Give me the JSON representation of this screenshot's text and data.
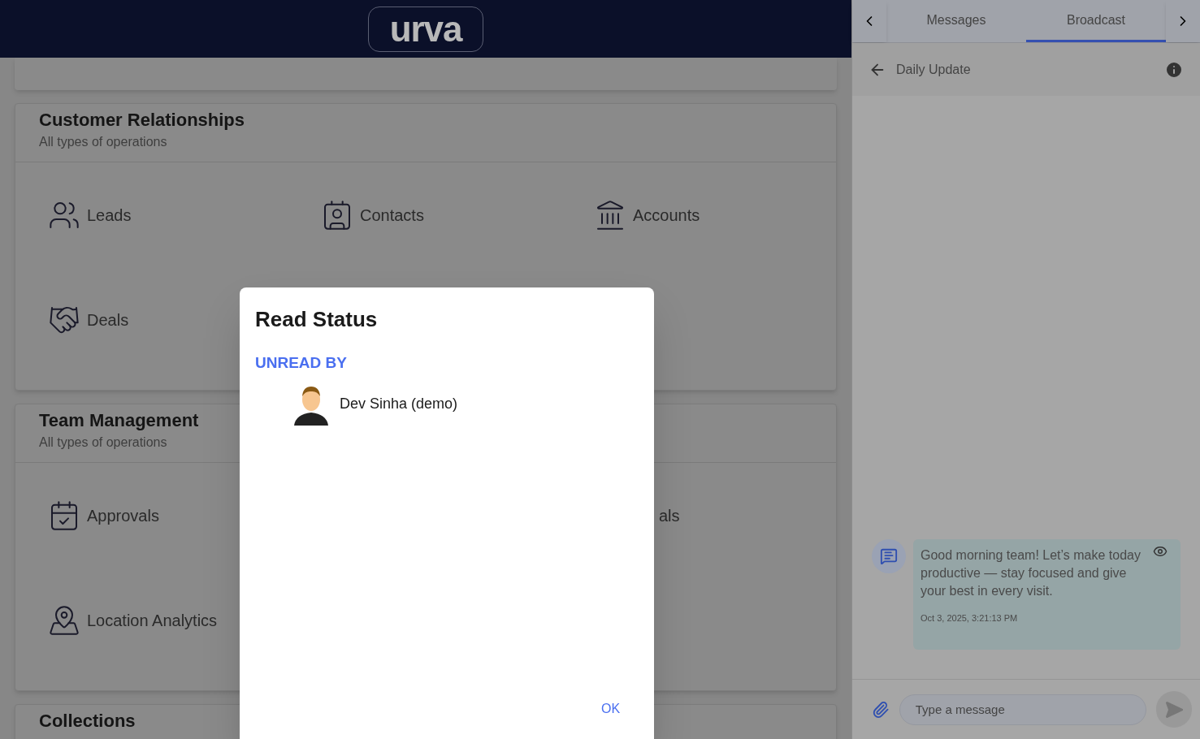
{
  "header": {
    "logo": "urva"
  },
  "sections": [
    {
      "title": "Customer Relationships",
      "subtitle": "All types of operations",
      "items": [
        {
          "kind": "leads",
          "label": "Leads"
        },
        {
          "kind": "contacts",
          "label": "Contacts"
        },
        {
          "kind": "accounts",
          "label": "Accounts"
        },
        {
          "kind": "deals",
          "label": "Deals"
        }
      ]
    },
    {
      "title": "Team Management",
      "subtitle": "All types of operations",
      "items": [
        {
          "kind": "approvals",
          "label": "Approvals"
        },
        {
          "kind": "hidden"
        },
        {
          "kind": "partial",
          "label": "als"
        },
        {
          "kind": "location",
          "label": "Location Analytics"
        }
      ]
    },
    {
      "title": "Collections"
    }
  ],
  "dialog": {
    "title": "Read Status",
    "group_label": "UNREAD BY",
    "people": [
      {
        "name": "Dev Sinha (demo)"
      }
    ],
    "ok_button": "OK"
  },
  "chat": {
    "tabs": [
      {
        "label": "Messages",
        "selected": false
      },
      {
        "label": "Broadcast",
        "selected": true
      }
    ],
    "conversation_title": "Daily Update",
    "messages": [
      {
        "text": "Good morning team! Let’s make today productive — stay focused and give your best in every visit.",
        "time": "Oct 3, 2025, 3:21:13 PM"
      }
    ],
    "input": {
      "placeholder": "Type a message"
    }
  }
}
